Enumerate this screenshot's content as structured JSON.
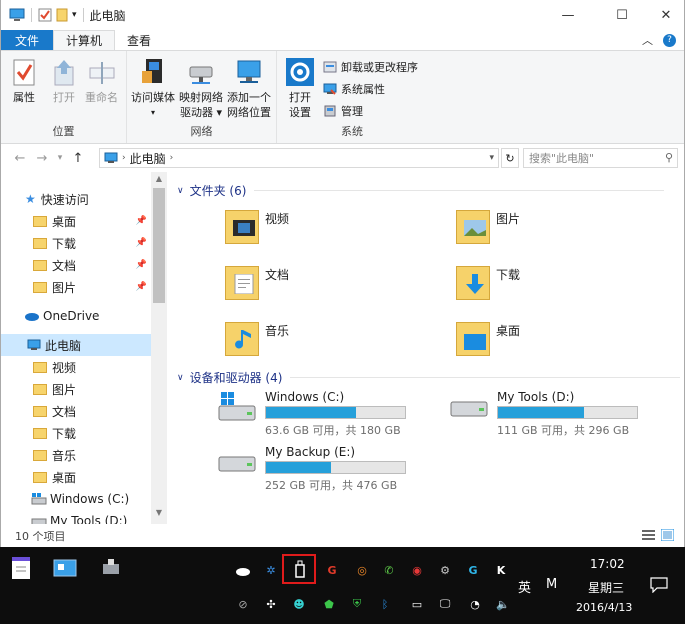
{
  "window": {
    "title": "此电脑",
    "minimize": "—",
    "maximize": "☐",
    "close": "✕"
  },
  "tabs": {
    "file": "文件",
    "computer": "计算机",
    "view": "查看"
  },
  "ribbon": {
    "location": {
      "label": "位置",
      "properties": "属性",
      "open": "打开",
      "rename": "重命名"
    },
    "network": {
      "label": "网络",
      "access_media": "访问媒体",
      "map_drive_l1": "映射网络",
      "map_drive_l2": "驱动器",
      "add_loc_l1": "添加一个",
      "add_loc_l2": "网络位置"
    },
    "system": {
      "label": "系统",
      "open_settings_l1": "打开",
      "open_settings_l2": "设置",
      "uninstall": "卸载或更改程序",
      "sys_props": "系统属性",
      "manage": "管理"
    }
  },
  "address": {
    "path": "此电脑",
    "search_placeholder": "搜索\"此电脑\""
  },
  "nav": {
    "quick_access": "快速访问",
    "quick_items": [
      "桌面",
      "下载",
      "文档",
      "图片"
    ],
    "onedrive": "OneDrive",
    "this_pc": "此电脑",
    "pc_items": [
      "视频",
      "图片",
      "文档",
      "下载",
      "音乐",
      "桌面"
    ],
    "drives": [
      "Windows (C:)",
      "My Tools (D:)"
    ]
  },
  "folders_section": {
    "title": "文件夹 (6)",
    "items": [
      "视频",
      "图片",
      "文档",
      "下载",
      "音乐",
      "桌面"
    ]
  },
  "drives_section": {
    "title": "设备和驱动器 (4)",
    "items": [
      {
        "name": "Windows (C:)",
        "free": "63.6 GB 可用，共 180 GB",
        "used_fraction": 0.65
      },
      {
        "name": "My Tools (D:)",
        "free": "111 GB 可用，共 296 GB",
        "used_fraction": 0.62
      },
      {
        "name": "My Backup (E:)",
        "free": "252 GB 可用，共 476 GB",
        "used_fraction": 0.47
      }
    ]
  },
  "status": {
    "items": "10 个项目"
  },
  "taskbar": {
    "time": "17:02",
    "weekday": "星期三",
    "ime": "英",
    "ime2": "M",
    "date": "2016/4/13"
  },
  "colors": {
    "accent": "#1979ca",
    "bar": "#26a0da",
    "selected": "#cce8ff"
  }
}
